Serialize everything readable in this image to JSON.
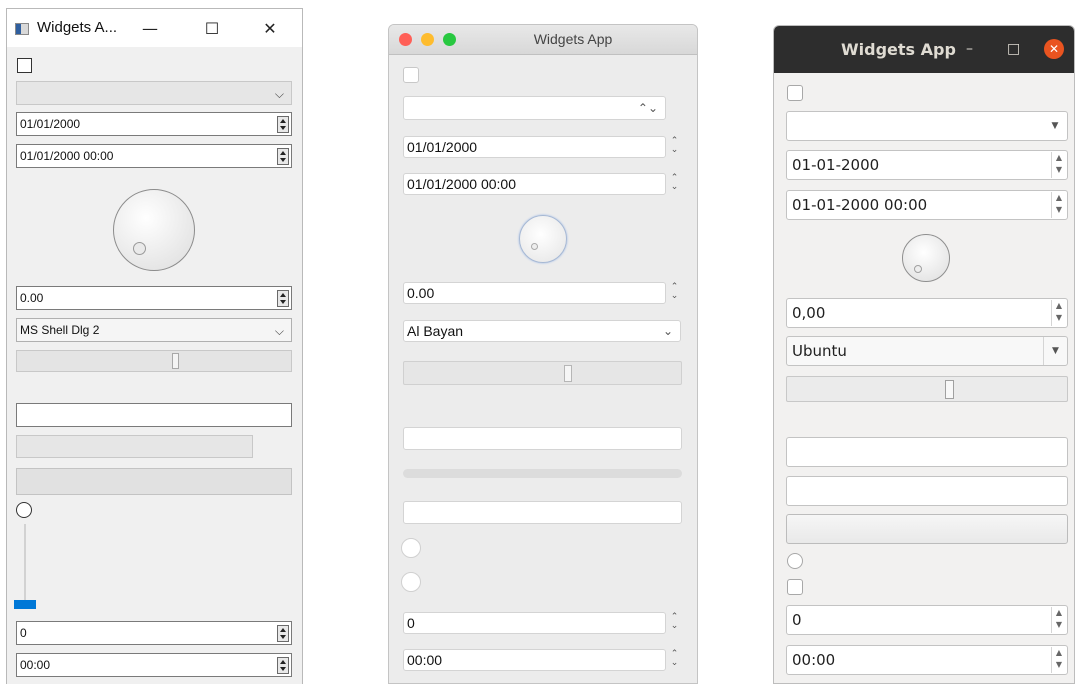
{
  "windows_app": {
    "title": "Widgets A...",
    "date": "01/01/2000",
    "datetime": "01/01/2000 00:00",
    "double": "0.00",
    "font": "MS Shell Dlg 2",
    "spin": "0",
    "time": "00:00",
    "caption_min": "—",
    "caption_max": "☐",
    "caption_close": "✕"
  },
  "mac_app": {
    "title": "Widgets App",
    "date": "01/01/2000",
    "datetime": "01/01/2000 00:00",
    "double": "0.00",
    "font": "Al Bayan",
    "spin": "0",
    "time": "00:00"
  },
  "ubuntu_app": {
    "title": "Widgets App",
    "date": "01-01-2000",
    "datetime": "01-01-2000 00:00",
    "double": "0,00",
    "font": "Ubuntu",
    "spin": "0",
    "time": "00:00",
    "caption_min": "–",
    "caption_max": "□",
    "caption_close": "✕"
  },
  "colors": {
    "windows_accent": "#0078d7",
    "mac_close": "#ff5f57",
    "mac_minimize": "#febc2e",
    "mac_zoom": "#28c840",
    "ubuntu_close": "#e95420",
    "ubuntu_titlebar": "#2d2d2d"
  }
}
